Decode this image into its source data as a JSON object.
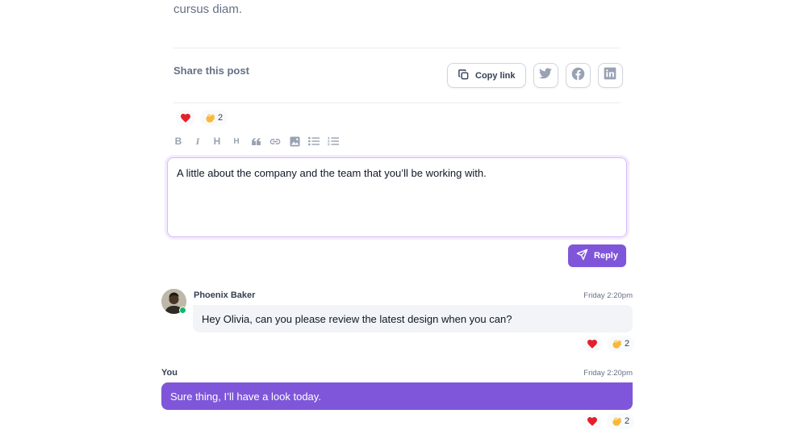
{
  "post": {
    "trailing_text": "cursus diam."
  },
  "share": {
    "label": "Share this post",
    "copy_link_label": "Copy link",
    "buttons": [
      {
        "icon": "twitter-icon"
      },
      {
        "icon": "facebook-icon"
      },
      {
        "icon": "linkedin-icon"
      }
    ]
  },
  "post_reactions": {
    "heart": "",
    "ok_hand_count": "2"
  },
  "editor": {
    "toolbar": [
      "B",
      "I",
      "H",
      "H"
    ],
    "value": "A little about the company and the team that you’ll be working with.",
    "reply_label": "Reply"
  },
  "messages": [
    {
      "author": "Phoenix Baker",
      "time": "Friday 2:20pm",
      "text": "Hey Olivia, can you please review the latest design when you can?",
      "reaction_count": "2"
    },
    {
      "author": "You",
      "time": "Friday 2:20pm",
      "text": "Sure thing, I’ll have a look today.",
      "reaction_count": "2"
    }
  ],
  "colors": {
    "accent": "#7f56d9",
    "muted_text": "#667085",
    "online": "#12b76a"
  }
}
